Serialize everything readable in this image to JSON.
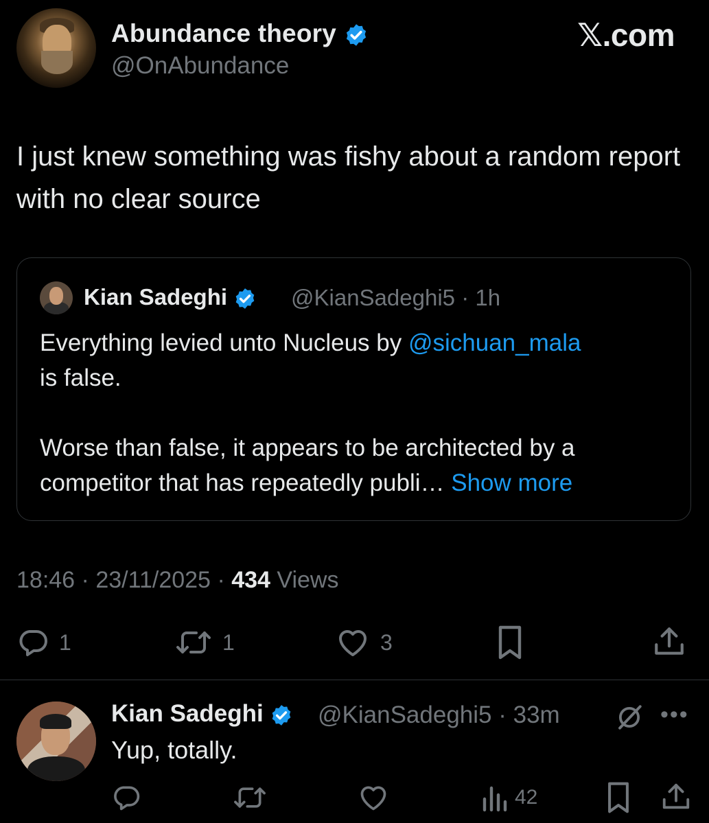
{
  "watermark": "𝕏.com",
  "post": {
    "author_name": "Abundance theory",
    "author_handle": "@OnAbundance",
    "text": "I just knew something was fishy about a random report with no clear source",
    "quote": {
      "author_name": "Kian Sadeghi",
      "author_handle": "@KianSadeghi5",
      "time": "1h",
      "text_part1": "Everything levied unto Nucleus by ",
      "mention": "@sichuan_mala",
      "text_part2": "is false.",
      "text_para2": "Worse than false, it appears to be architected by a competitor that has repeatedly publi…",
      "show_more": "Show more"
    },
    "time": "18:46",
    "date": "23/11/2025",
    "views_count": "434",
    "views_label": "Views",
    "actions": {
      "replies": "1",
      "reposts": "1",
      "likes": "3"
    }
  },
  "reply": {
    "author_name": "Kian Sadeghi",
    "author_handle": "@KianSadeghi5",
    "time": "33m",
    "text": "Yup, totally.",
    "views": "42"
  },
  "colors": {
    "background": "#000000",
    "text": "#e7e9ea",
    "muted": "#71767b",
    "link": "#1d9bf0",
    "verified": "#1d9bf0"
  }
}
